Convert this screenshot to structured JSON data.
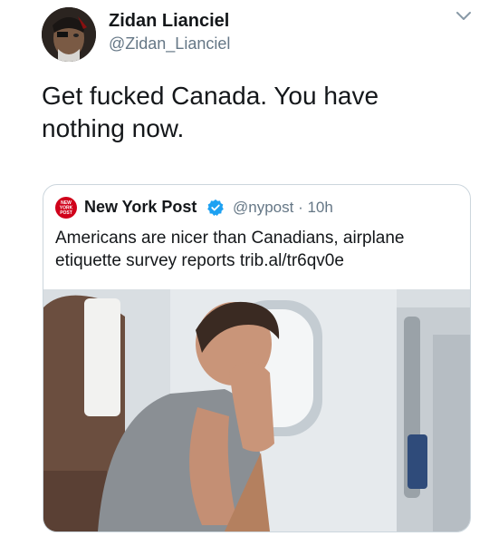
{
  "author": {
    "name": "Zidan Lianciel",
    "handle": "@Zidan_Lianciel"
  },
  "tweet": {
    "text": "Get fucked Canada. You have nothing now."
  },
  "quoted": {
    "name": "New York Post",
    "handle": "@nypost",
    "time": "· 10h",
    "text": "Americans are nicer than Canadians, airplane etiquette survey reports trib.al/tr6qv0e",
    "logo_text": [
      "NEW",
      "YORK",
      "POST"
    ]
  },
  "colors": {
    "verified": "#1da1f2",
    "secondary_text": "#657786",
    "nyp_red": "#d0021b",
    "card_border": "#ccd6dd"
  },
  "icons": {
    "menu": "chevron-down-icon",
    "verified": "verified-badge-icon"
  }
}
